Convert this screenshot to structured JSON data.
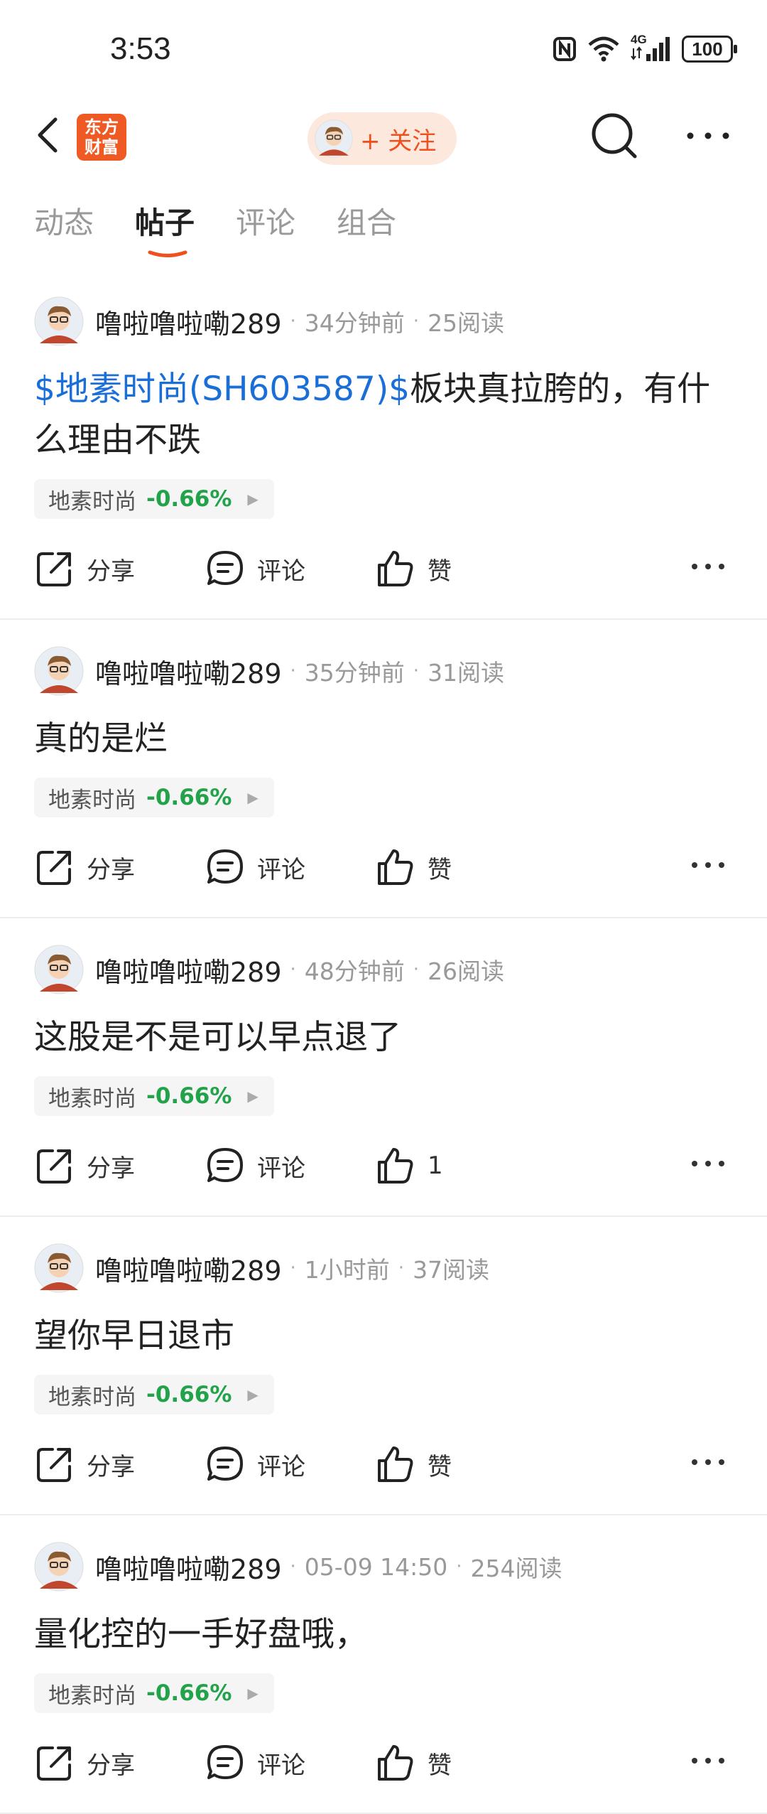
{
  "status_bar": {
    "time": "3:53",
    "network": "4G",
    "battery": "100"
  },
  "header": {
    "logo_line1": "东方",
    "logo_line2": "财富",
    "follow_label": "+ 关注"
  },
  "tabs": [
    {
      "label": "动态",
      "active": false
    },
    {
      "label": "帖子",
      "active": true
    },
    {
      "label": "评论",
      "active": false
    },
    {
      "label": "组合",
      "active": false
    }
  ],
  "actions_labels": {
    "share": "分享",
    "comment": "评论"
  },
  "posts": [
    {
      "user": "噜啦噜啦嘞289",
      "time": "34分钟前",
      "reads": "25阅读",
      "stock_link": "$地素时尚(SH603587)$",
      "content": "板块真拉胯的，有什么理由不跌",
      "tag_name": "地素时尚",
      "tag_pct": "-0.66%",
      "like_label": "赞"
    },
    {
      "user": "噜啦噜啦嘞289",
      "time": "35分钟前",
      "reads": "31阅读",
      "stock_link": "",
      "content": "真的是烂",
      "tag_name": "地素时尚",
      "tag_pct": "-0.66%",
      "like_label": "赞"
    },
    {
      "user": "噜啦噜啦嘞289",
      "time": "48分钟前",
      "reads": "26阅读",
      "stock_link": "",
      "content": "这股是不是可以早点退了",
      "tag_name": "地素时尚",
      "tag_pct": "-0.66%",
      "like_label": "1"
    },
    {
      "user": "噜啦噜啦嘞289",
      "time": "1小时前",
      "reads": "37阅读",
      "stock_link": "",
      "content": "望你早日退市",
      "tag_name": "地素时尚",
      "tag_pct": "-0.66%",
      "like_label": "赞"
    },
    {
      "user": "噜啦噜啦嘞289",
      "time": "05-09 14:50",
      "reads": "254阅读",
      "stock_link": "",
      "content": "量化控的一手好盘哦，",
      "tag_name": "地素时尚",
      "tag_pct": "-0.66%",
      "like_label": "赞"
    }
  ],
  "colors": {
    "accent": "#f0501e",
    "link": "#1a6ed8",
    "down_green": "#22a34a"
  }
}
